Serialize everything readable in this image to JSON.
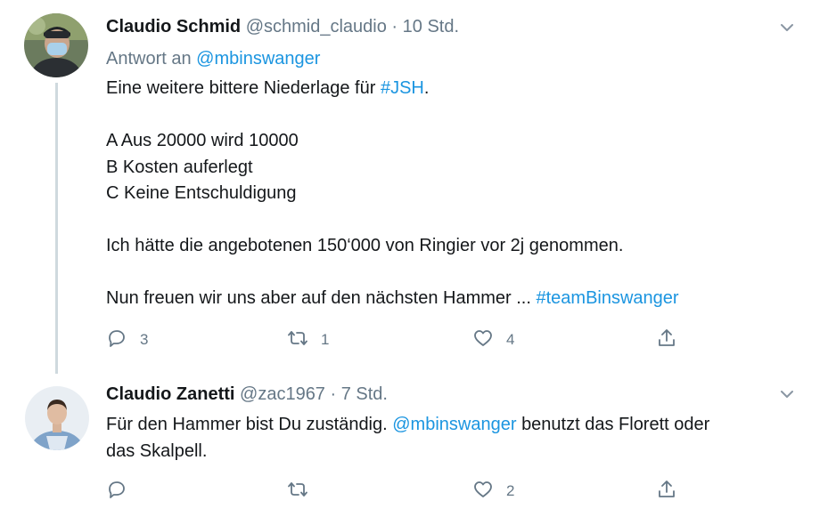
{
  "tweets": [
    {
      "name": "Claudio Schmid",
      "handle": "@schmid_claudio",
      "separator": "·",
      "time": "10 Std.",
      "reply_prefix": "Antwort an",
      "reply_to": "@mbinswanger",
      "lines": {
        "l1_text": "Eine weitere bittere Niederlage für",
        "l1_hashtag": "#JSH",
        "l1_end": ".",
        "l2": "A Aus 20000 wird 10000",
        "l3": "B Kosten auferlegt",
        "l4": "C Keine Entschuldigung",
        "l5": "Ich hätte die angebotenen 150‘000 von Ringier vor 2j genommen.",
        "l6_text": "Nun freuen wir uns aber auf den nächsten Hammer ...",
        "l6_hashtag": "#teamBinswanger"
      },
      "replies": "3",
      "retweets": "1",
      "likes": "4",
      "avatar_color": "#3b4a3a"
    },
    {
      "name": "Claudio Zanetti",
      "handle": "@zac1967",
      "separator": "·",
      "time": "7 Std.",
      "lines": {
        "l1_text": "Für den Hammer bist Du zuständig.",
        "l1_mention": "@mbinswanger",
        "l1_end": "benutzt das Florett oder",
        "l2": "das Skalpell."
      },
      "likes": "2",
      "avatar_color": "#7fa3c9"
    }
  ],
  "colors": {
    "text": "#14171a",
    "muted": "#657786",
    "link": "#1b95e0",
    "thread_line": "#cfd9de"
  },
  "icons": [
    "reply-icon",
    "retweet-icon",
    "like-icon",
    "share-icon",
    "chevron-down-icon"
  ]
}
